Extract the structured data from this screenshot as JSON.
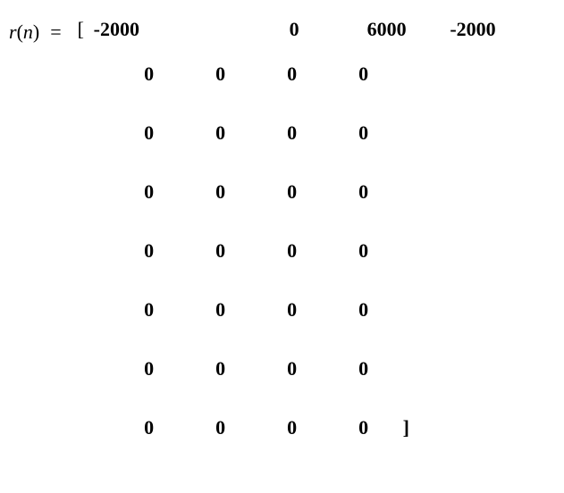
{
  "equation": {
    "lhs_fn": "r",
    "lhs_arg": "n",
    "equals": "=",
    "open_bracket": "[",
    "close_bracket": "]",
    "first_row": [
      "-2000",
      "0",
      "6000",
      "-2000"
    ],
    "zero_rows": [
      [
        "0",
        "0",
        "0",
        "0"
      ],
      [
        "0",
        "0",
        "0",
        "0"
      ],
      [
        "0",
        "0",
        "0",
        "0"
      ],
      [
        "0",
        "0",
        "0",
        "0"
      ],
      [
        "0",
        "0",
        "0",
        "0"
      ],
      [
        "0",
        "0",
        "0",
        "0"
      ],
      [
        "0",
        "0",
        "0",
        "0"
      ]
    ]
  }
}
